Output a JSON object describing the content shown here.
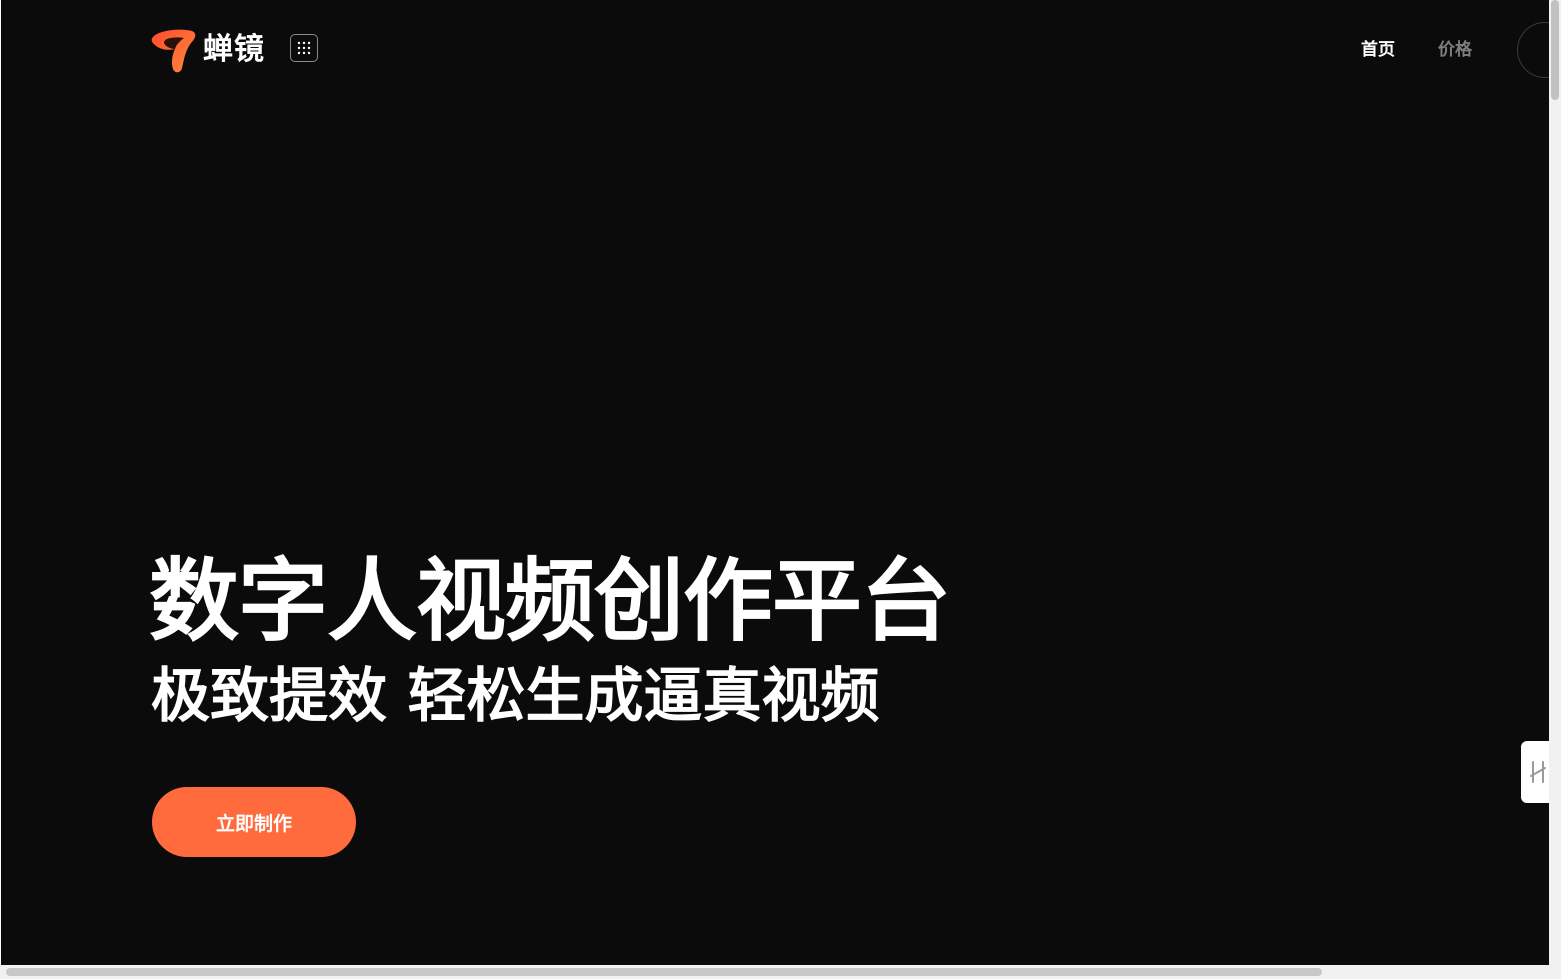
{
  "header": {
    "brand_name": "蝉镜",
    "nav": [
      {
        "label": "首页",
        "active": true
      },
      {
        "label": "价格",
        "active": false
      }
    ]
  },
  "hero": {
    "title": "数字人视频创作平台",
    "subtitle": "极致提效 轻松生成逼真视频",
    "cta_label": "立即制作"
  },
  "icons": {
    "logo": "chanjing-logo-icon",
    "apps": "grid-apps-icon",
    "side_tab": "sidebar-toggle-icon",
    "user": "user-avatar-icon"
  },
  "colors": {
    "background": "#0b0b0c",
    "accent": "#ff6b3d",
    "text_primary": "#ffffff",
    "text_muted": "#7f7f7f"
  }
}
